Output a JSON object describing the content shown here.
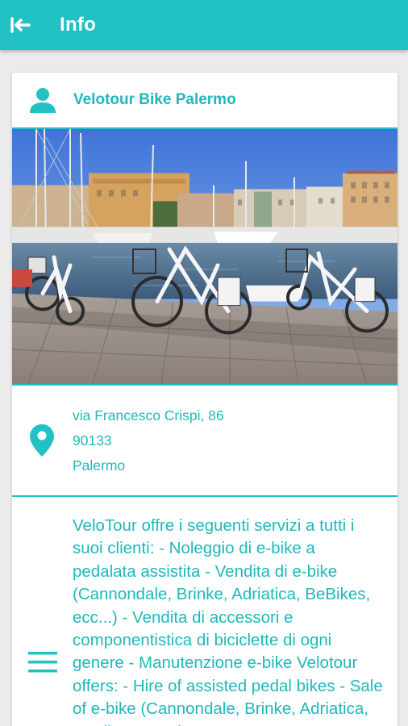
{
  "appbar": {
    "title": "Info",
    "back_icon": "back-arrow-icon",
    "color": "#22c1c3"
  },
  "card": {
    "name": "Velotour Bike Palermo",
    "user_icon": "user-icon",
    "photo_icon": "bikes-harbor-photo",
    "address": {
      "street": "via Francesco Crispi, 86",
      "zip": "90133",
      "city": "Palermo",
      "icon": "map-pin-icon"
    },
    "description": "VeloTour offre i seguenti servizi a tutti i suoi clienti: - Noleggio di e-bike a pedalata assistita - Vendita di e-bike (Cannondale, Brinke, Adriatica, BeBikes, ecc...) - Vendita di accessori e componentistica di biciclette di ogni genere - Manutenzione e-bike Velotour offers: - Hire of assisted pedal bikes - Sale of e-bike (Cannondale, Brinke, Adriatica, BeBikes, etc...)",
    "description_icon": "menu-icon",
    "accent_color": "#1fb8ba"
  }
}
